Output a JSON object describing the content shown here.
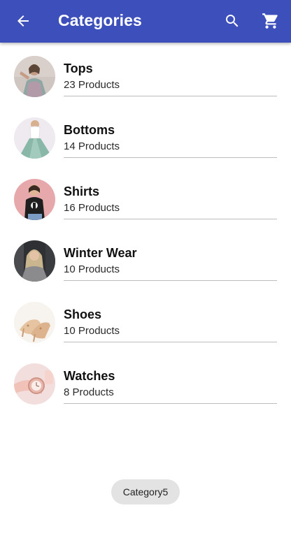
{
  "header": {
    "title": "Categories",
    "back_icon": "arrow-back-icon",
    "search_icon": "search-icon",
    "cart_icon": "cart-icon",
    "background": "#3d4fba"
  },
  "categories": [
    {
      "name": "Tops",
      "count": "23 Products",
      "image": "tops-photo"
    },
    {
      "name": "Bottoms",
      "count": "14 Products",
      "image": "bottoms-photo"
    },
    {
      "name": "Shirts",
      "count": "16 Products",
      "image": "shirts-photo"
    },
    {
      "name": "Winter Wear",
      "count": "10 Products",
      "image": "winter-wear-photo"
    },
    {
      "name": "Shoes",
      "count": "10 Products",
      "image": "shoes-photo"
    },
    {
      "name": "Watches",
      "count": "8 Products",
      "image": "watches-photo"
    }
  ],
  "toast": {
    "label": "Category5"
  }
}
